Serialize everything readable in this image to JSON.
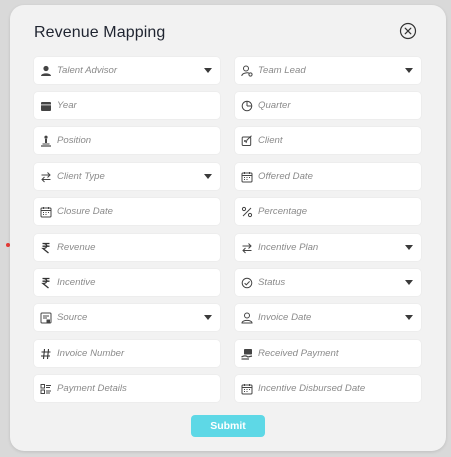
{
  "modal": {
    "title": "Revenue Mapping",
    "close_icon": "close-circle-icon",
    "submit_label": "Submit"
  },
  "colors": {
    "background": "#d9d9d9",
    "modal": "#f2f2f2",
    "field": "#ffffff",
    "submit": "#5ed8e6",
    "placeholder": "#8a8a8a"
  },
  "fields": {
    "talent_advisor": {
      "label": "Talent Advisor",
      "icon": "user-icon",
      "type": "select"
    },
    "team_lead": {
      "label": "Team Lead",
      "icon": "user-settings-icon",
      "type": "select"
    },
    "year": {
      "label": "Year",
      "icon": "calendar-year-icon",
      "type": "input"
    },
    "quarter": {
      "label": "Quarter",
      "icon": "pie-clock-icon",
      "type": "input"
    },
    "position": {
      "label": "Position",
      "icon": "person-position-icon",
      "type": "input"
    },
    "client": {
      "label": "Client",
      "icon": "client-edit-icon",
      "type": "input"
    },
    "client_type": {
      "label": "Client Type",
      "icon": "swap-arrows-icon",
      "type": "select"
    },
    "offered_date": {
      "label": "Offered Date",
      "icon": "calendar-icon",
      "type": "input"
    },
    "closure_date": {
      "label": "Closure Date",
      "icon": "calendar-icon",
      "type": "input"
    },
    "percentage": {
      "label": "Percentage",
      "icon": "percent-icon",
      "type": "input"
    },
    "revenue": {
      "label": "Revenue",
      "icon": "rupee-icon",
      "type": "input"
    },
    "incentive_plan": {
      "label": "Incentive Plan",
      "icon": "swap-arrows-icon",
      "type": "select"
    },
    "incentive": {
      "label": "Incentive",
      "icon": "rupee-icon",
      "type": "input"
    },
    "status": {
      "label": "Status",
      "icon": "status-check-icon",
      "type": "select"
    },
    "source": {
      "label": "Source",
      "icon": "source-list-icon",
      "type": "select"
    },
    "invoice_date": {
      "label": "Invoice Date",
      "icon": "person-icon",
      "type": "select"
    },
    "invoice_number": {
      "label": "Invoice Number",
      "icon": "hash-icon",
      "type": "input"
    },
    "received_payment": {
      "label": "Received  Payment",
      "icon": "payment-received-icon",
      "type": "input"
    },
    "payment_details": {
      "label": "Payment Details",
      "icon": "list-details-icon",
      "type": "input"
    },
    "incentive_disbursed_date": {
      "label": "Incentive Disbursed Date",
      "icon": "calendar-icon",
      "type": "input"
    }
  }
}
